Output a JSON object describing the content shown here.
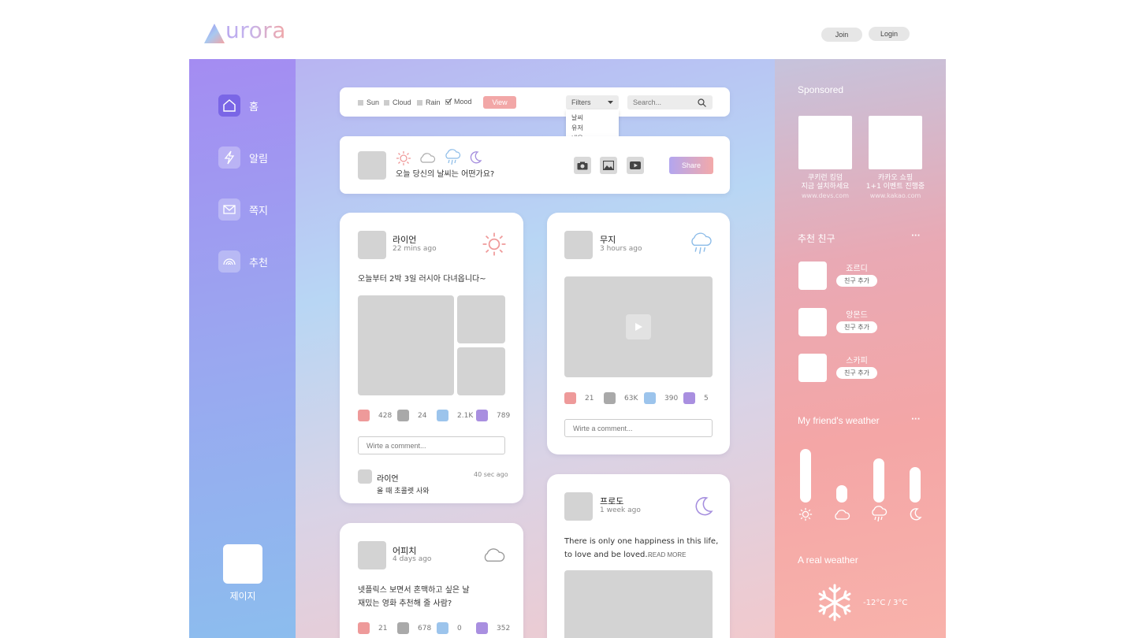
{
  "header": {
    "logo_text": "urora",
    "join_label": "Join",
    "login_label": "Login"
  },
  "sidebar": {
    "items": [
      {
        "label": "홈"
      },
      {
        "label": "알림"
      },
      {
        "label": "쪽지"
      },
      {
        "label": "추천"
      }
    ],
    "profile_name": "제이지"
  },
  "filter_bar": {
    "options": [
      "Sun",
      "Cloud",
      "Rain",
      "Mood"
    ],
    "view_label": "View",
    "filters_label": "Filters",
    "filters_options": [
      "날씨",
      "유저",
      "내용"
    ],
    "search_placeholder": "Search..."
  },
  "composer": {
    "prompt": "오늘 당신의 날씨는 어떤가요?",
    "share_label": "Share"
  },
  "posts": [
    {
      "user": "라이언",
      "time": "22 mins ago",
      "weather_icon": "sun-icon",
      "text": "오늘부터 2박 3일 러시아 다녀옵니다~",
      "reactions": [
        "428",
        "24",
        "2.1K",
        "789"
      ],
      "comment_placeholder": "Wirte a comment...",
      "comment": {
        "user": "라이언",
        "time": "40 sec ago",
        "text": "올 때 초콜렛 사와"
      }
    },
    {
      "user": "무지",
      "time": "3 hours ago",
      "weather_icon": "rain-icon",
      "reactions": [
        "21",
        "63K",
        "390",
        "5"
      ],
      "comment_placeholder": "Wirte a comment..."
    },
    {
      "user": "어피치",
      "time": "4 days ago",
      "weather_icon": "cloud-icon",
      "text_line1": "넷플릭스 보면서 혼맥하고 싶은 날",
      "text_line2": "재밌는 영화 추천해 줄 사람?",
      "reactions": [
        "21",
        "678",
        "0",
        "352"
      ]
    },
    {
      "user": "프로도",
      "time": "1 week ago",
      "weather_icon": "moon-icon",
      "text_line1": "There is only one happiness in this life,",
      "text_line2": "to love and be loved...",
      "read_more": "READ MORE"
    }
  ],
  "reaction_colors": [
    "#ee9a9a",
    "#a9a9a9",
    "#9cc4ec",
    "#a98fe0"
  ],
  "right_panel": {
    "sponsored_title": "Sponsored",
    "sponsors": [
      {
        "line1": "쿠키런 킹덤",
        "line2": "지금 설치하세요",
        "url": "www.devs.com"
      },
      {
        "line1": "카카오 쇼핑",
        "line2": "1+1 이벤트 진행중",
        "url": "www.kakao.com"
      }
    ],
    "friends_title": "추천 친구",
    "more": "···",
    "friends": [
      {
        "name": "죠르디",
        "button": "친구 추가"
      },
      {
        "name": "앙몬드",
        "button": "친구 추가"
      },
      {
        "name": "스카피",
        "button": "친구 추가"
      }
    ],
    "weather_title": "My friend's weather",
    "weather_levels": [
      0.95,
      0.3,
      0.78,
      0.62
    ],
    "real_weather_title": "A real weather",
    "real_weather_temp": "-12°C / 3°C"
  }
}
